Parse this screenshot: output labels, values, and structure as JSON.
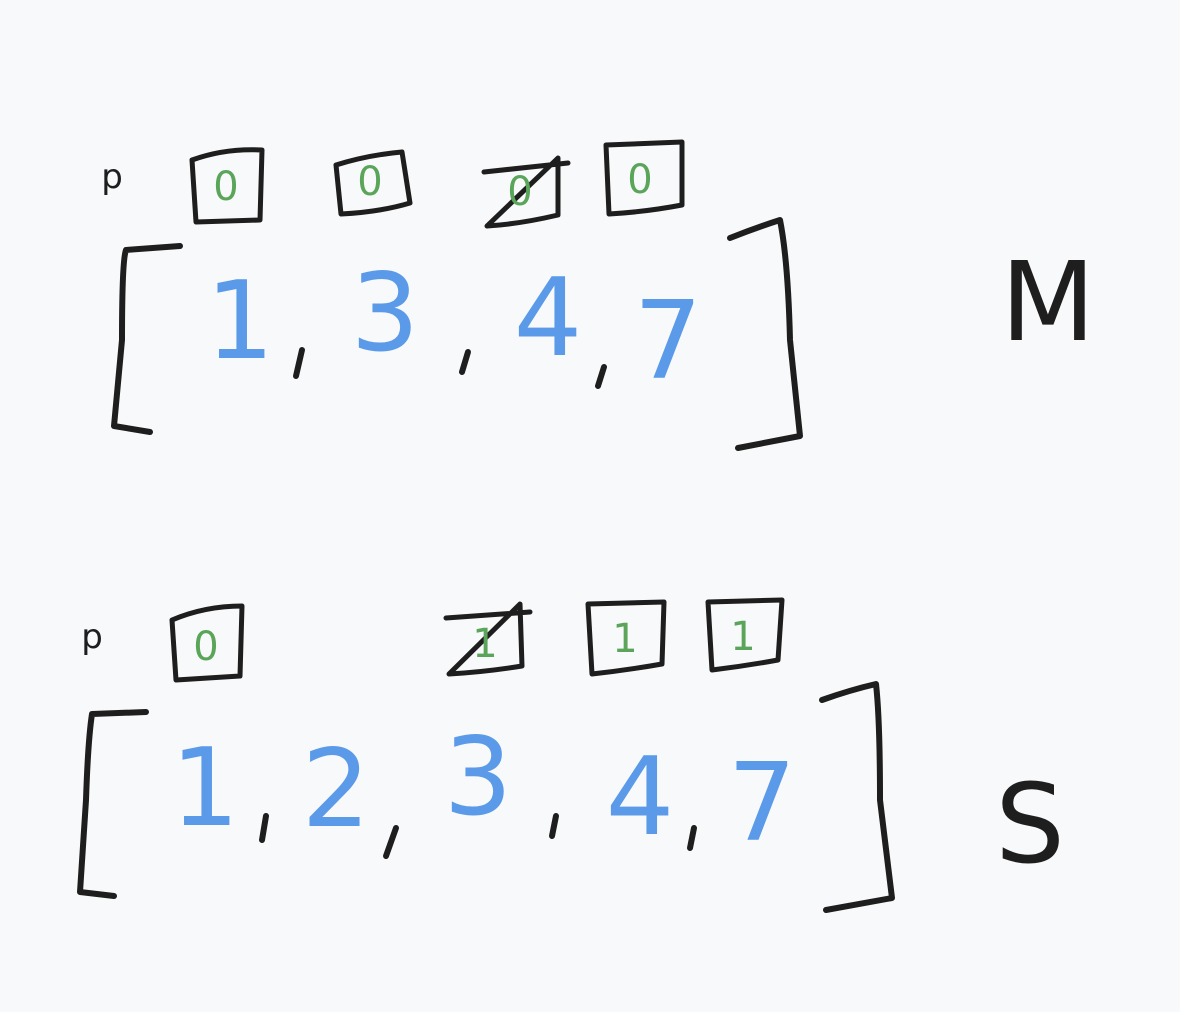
{
  "colors": {
    "ink": "#1e1e1e",
    "number": "#5b9ae8",
    "flag": "#5aa55a",
    "background": "#f8f9fa"
  },
  "arrays": [
    {
      "name": "M",
      "pointer_label": "p",
      "values": [
        "1",
        "3",
        "4",
        "7"
      ],
      "flags": [
        "0",
        "0",
        "0",
        "0"
      ]
    },
    {
      "name": "S",
      "pointer_label": "p",
      "values": [
        "1",
        "2",
        "3",
        "4",
        "7"
      ],
      "flags": [
        "0",
        "1",
        "1",
        "1"
      ]
    }
  ]
}
